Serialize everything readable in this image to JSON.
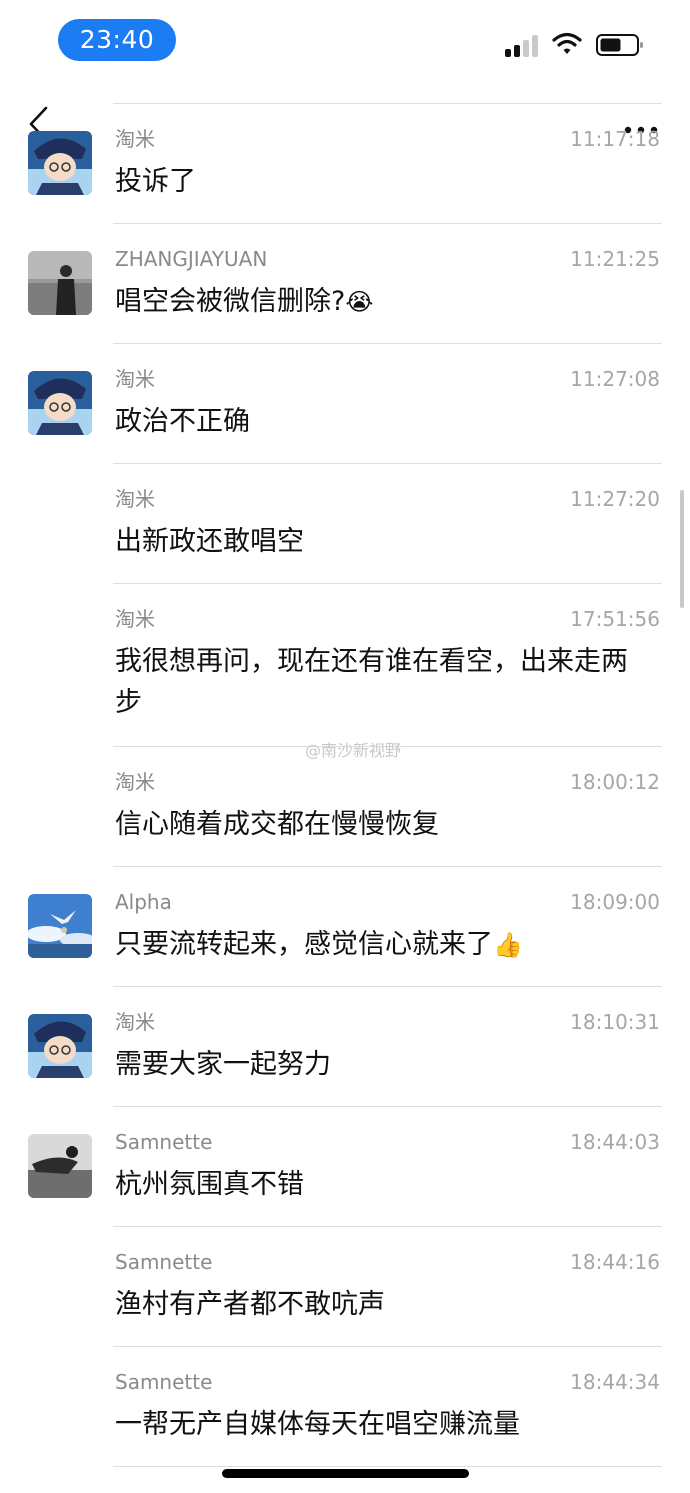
{
  "status": {
    "time": "23:40"
  },
  "nav": {
    "back_icon": "chevron-left-icon",
    "more_icon": "more-dots-icon"
  },
  "watermark": "@南沙新视野",
  "messages": [
    {
      "sender": "淘米",
      "time": "11:17:18",
      "text": "投诉了",
      "avatar": "anime"
    },
    {
      "sender": "ZHANGJIAYUAN",
      "time": "11:21:25",
      "text": "唱空会被微信删除?",
      "emoji": "😭",
      "avatar": "person-sea"
    },
    {
      "sender": "淘米",
      "time": "11:27:08",
      "text": "政治不正确",
      "avatar": "anime"
    },
    {
      "sender": "淘米",
      "time": "11:27:20",
      "text": "出新政还敢唱空",
      "avatar": ""
    },
    {
      "sender": "淘米",
      "time": "17:51:56",
      "text": "我很想再问，现在还有谁在看空，出来走两步",
      "avatar": ""
    },
    {
      "sender": "淘米",
      "time": "18:00:12",
      "text": "信心随着成交都在慢慢恢复",
      "avatar": ""
    },
    {
      "sender": "Alpha",
      "time": "18:09:00",
      "text": "只要流转起来，感觉信心就来了",
      "emoji": "👍",
      "avatar": "bird-sky"
    },
    {
      "sender": "淘米",
      "time": "18:10:31",
      "text": "需要大家一起努力",
      "avatar": "anime"
    },
    {
      "sender": "Samnette",
      "time": "18:44:03",
      "text": "杭州氛围真不错",
      "avatar": "bw-photo"
    },
    {
      "sender": "Samnette",
      "time": "18:44:16",
      "text": "渔村有产者都不敢吭声",
      "avatar": ""
    },
    {
      "sender": "Samnette",
      "time": "18:44:34",
      "text": "一帮无产自媒体每天在唱空赚流量",
      "avatar": ""
    }
  ]
}
